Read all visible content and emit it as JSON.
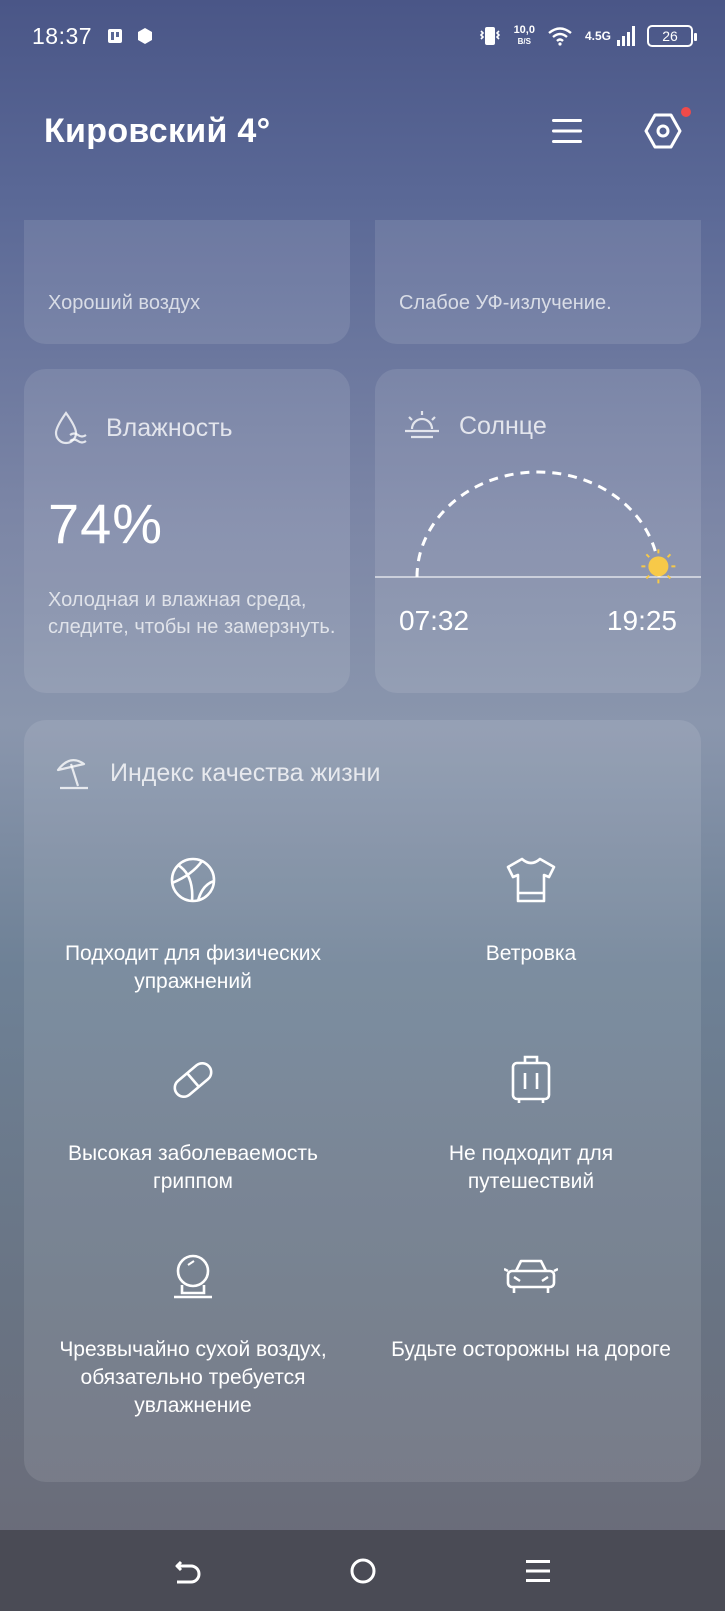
{
  "status": {
    "time": "18:37",
    "net_speed_value": "10,0",
    "net_speed_unit": "B/S",
    "network_gen": "4.5G",
    "battery": "26"
  },
  "header": {
    "city_title": "Кировский 4°"
  },
  "top_cards": {
    "air_caption": "Хороший воздух",
    "uv_caption": "Слабое УФ-излучение."
  },
  "humidity": {
    "label": "Влажность",
    "value": "74%",
    "description": "Холодная и влажная среда, следите, чтобы не замерзнуть."
  },
  "sun": {
    "label": "Солнце",
    "sunrise": "07:32",
    "sunset": "19:25",
    "day_progress": 0.97
  },
  "life_index": {
    "title": "Индекс качества жизни",
    "items": [
      {
        "icon": "basketball-icon",
        "text": "Подходит для физических упражнений"
      },
      {
        "icon": "tshirt-icon",
        "text": "Ветровка"
      },
      {
        "icon": "pill-icon",
        "text": "Высокая заболеваемость гриппом"
      },
      {
        "icon": "suitcase-icon",
        "text": "Не подходит для путешествий"
      },
      {
        "icon": "humidifier-icon",
        "text": "Чрезвычайно сухой воздух, обязательно требуется увлажнение"
      },
      {
        "icon": "car-icon",
        "text": "Будьте осторожны на дороге"
      }
    ]
  },
  "colors": {
    "notification_dot": "#f04a4a",
    "sun_color": "#f7c948"
  }
}
